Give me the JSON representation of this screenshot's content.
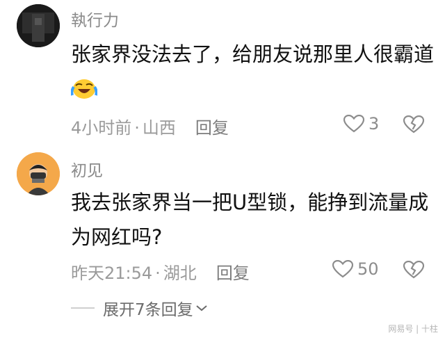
{
  "comments": [
    {
      "username": "執行力",
      "text_before_emoji": "张家界没法去了，给朋友说那里人很霸道",
      "emoji": "laughing-crying-emoji",
      "time": "4小时前",
      "separator": "·",
      "location": "山西",
      "reply_label": "回复",
      "likes": "3"
    },
    {
      "username": "初见",
      "text": "我去张家界当一把U型锁，能挣到流量成为网红吗?",
      "time": "昨天21:54",
      "separator": "·",
      "location": "湖北",
      "reply_label": "回复",
      "likes": "50"
    }
  ],
  "expand_replies": "展开7条回复",
  "icons": {
    "like": "heart-outline-icon",
    "dislike": "broken-heart-icon",
    "expand": "chevron-down-icon"
  },
  "watermark": "网易号 | 十柱",
  "colors": {
    "username": "#8a8a8a",
    "text": "#111111",
    "meta": "#9a9a9a",
    "background": "#ffffff"
  }
}
